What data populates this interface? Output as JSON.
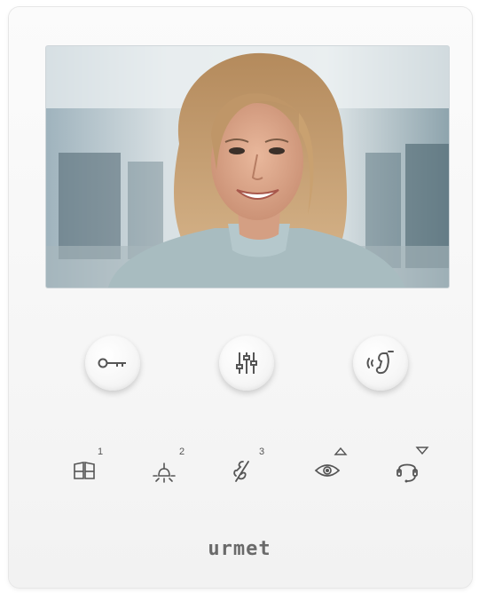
{
  "device": {
    "brand": "urmet",
    "video_screen": {
      "content": "visitor-smiling-woman"
    },
    "main_buttons": [
      {
        "name": "door-open",
        "icon": "key-icon"
      },
      {
        "name": "settings",
        "icon": "sliders-icon"
      },
      {
        "name": "answer-call",
        "icon": "handset-sound-icon"
      }
    ],
    "touch_keys": [
      {
        "name": "aux-1",
        "icon": "gate-icon",
        "badge": "1"
      },
      {
        "name": "aux-2",
        "icon": "light-icon",
        "badge": "2"
      },
      {
        "name": "aux-3",
        "icon": "mute-ringer-icon",
        "badge": "3"
      },
      {
        "name": "autoinsertion-up",
        "icon": "eye-icon",
        "badge": "up"
      },
      {
        "name": "intercom-down",
        "icon": "headset-icon",
        "badge": "down"
      }
    ],
    "colors": {
      "panel": "#f6f6f6",
      "icon": "#5a5a5a"
    }
  }
}
